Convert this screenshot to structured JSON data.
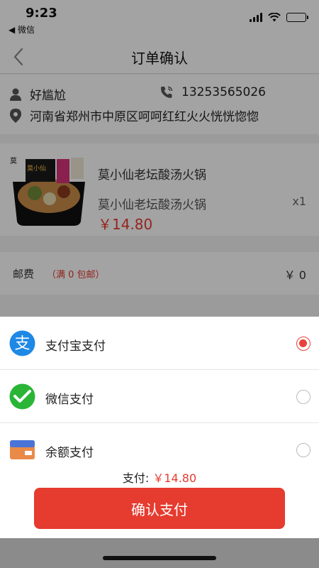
{
  "status_bar": {
    "time": "9:23",
    "back_app": "◀ 微信"
  },
  "nav": {
    "title": "订单确认"
  },
  "address": {
    "name": "好尴尬",
    "phone": "13253565026",
    "detail": "河南省郑州市中原区呵呵红红火火恍恍惚惚"
  },
  "product": {
    "name": "莫小仙老坛酸汤火锅",
    "spec": "莫小仙老坛酸汤火锅",
    "quantity": "x1",
    "price": "￥14.80"
  },
  "shipping": {
    "label": "邮费",
    "note": "（满 0 包邮）",
    "value": "￥ 0"
  },
  "payment_methods": [
    {
      "label": "支付宝支付",
      "icon": "alipay-icon",
      "selected": true
    },
    {
      "label": "微信支付",
      "icon": "wechat-pay-icon",
      "selected": false
    },
    {
      "label": "余额支付",
      "icon": "balance-card-icon",
      "selected": false
    }
  ],
  "total": {
    "label": "支付:",
    "amount": "￥14.80"
  },
  "confirm_button": "确认支付",
  "colors": {
    "accent": "#e63b2f",
    "alipay": "#1e88e5",
    "wechat": "#2ab536"
  }
}
